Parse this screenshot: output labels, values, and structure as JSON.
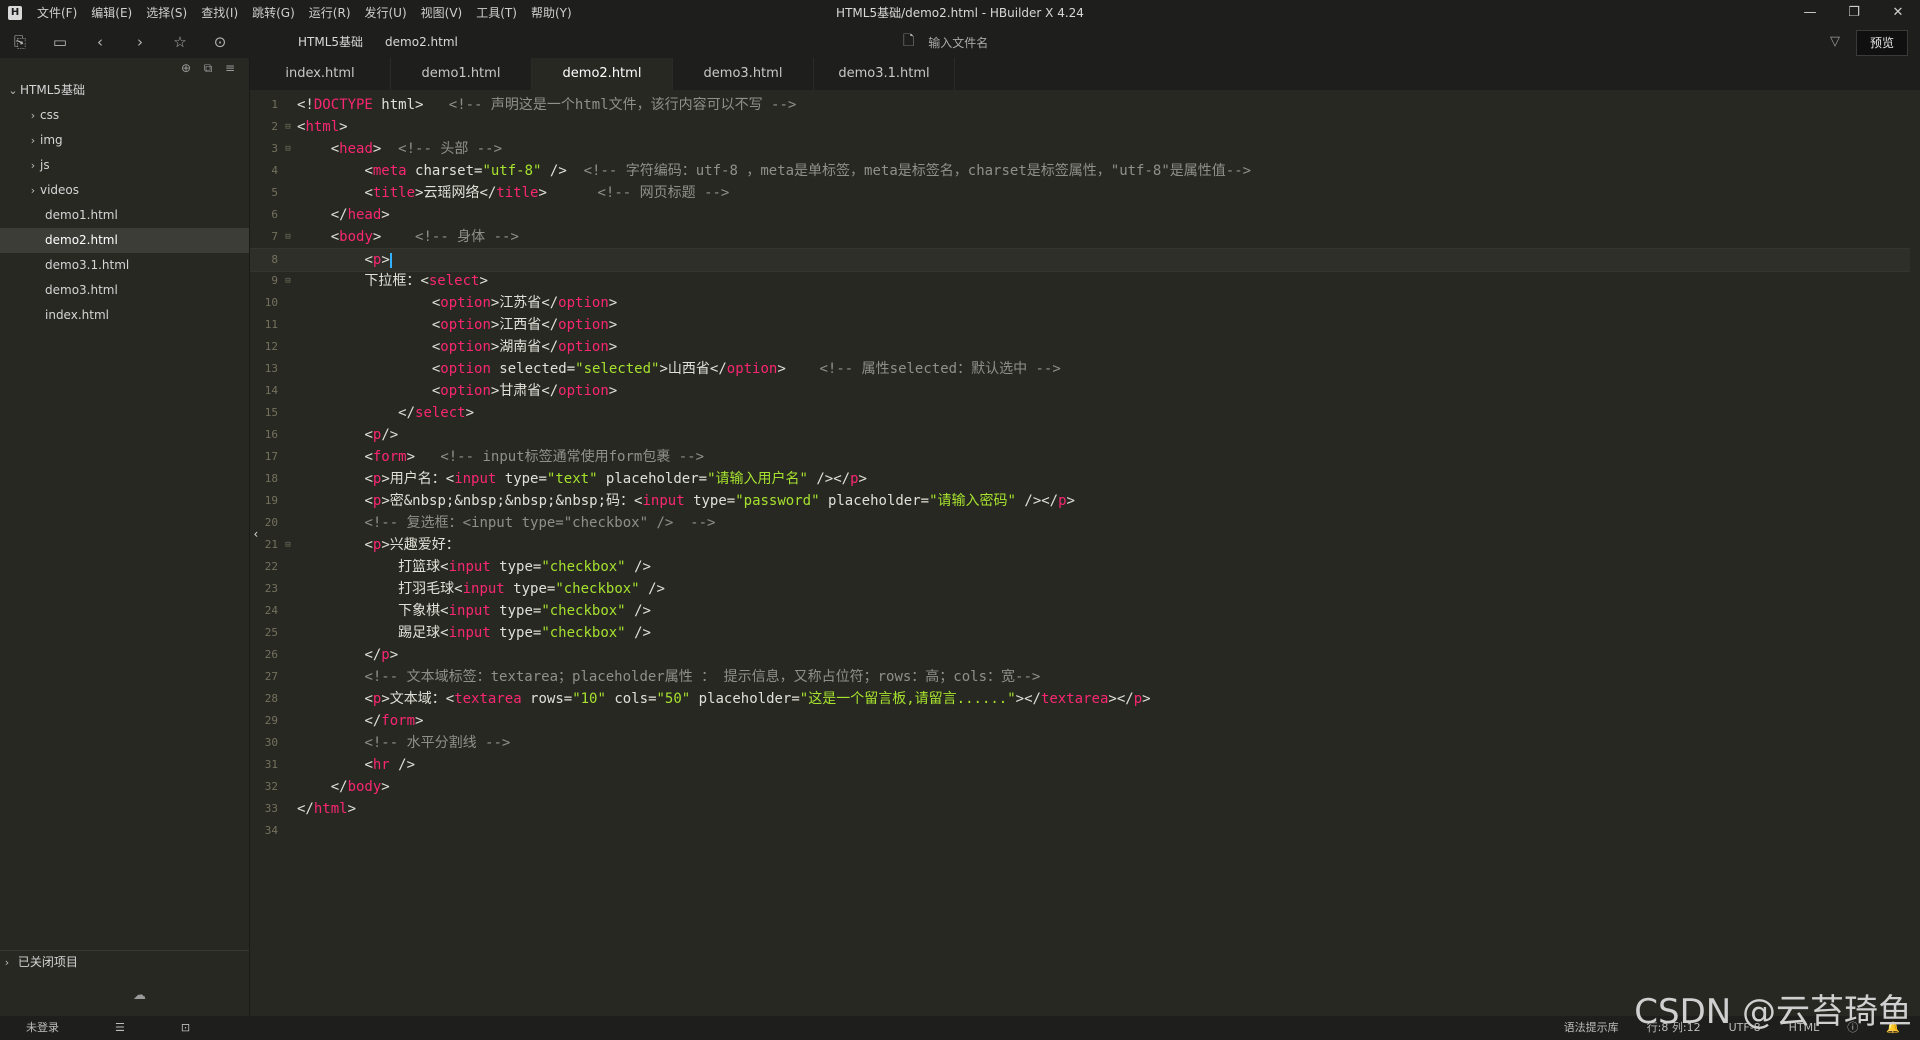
{
  "titlebar": {
    "menus": [
      "文件(F)",
      "编辑(E)",
      "选择(S)",
      "查找(I)",
      "跳转(G)",
      "运行(R)",
      "发行(U)",
      "视图(V)",
      "工具(T)",
      "帮助(Y)"
    ],
    "window_title": "HTML5基础/demo2.html - HBuilder X 4.24"
  },
  "toolbar": {
    "breadcrumb_project": "HTML5基础",
    "breadcrumb_file": "demo2.html",
    "file_search_placeholder": "输入文件名",
    "preview_label": "预览"
  },
  "sidebar": {
    "project_name": "HTML5基础",
    "folders": [
      "css",
      "img",
      "js",
      "videos"
    ],
    "files": [
      "demo1.html",
      "demo2.html",
      "demo3.1.html",
      "demo3.html",
      "index.html"
    ],
    "selected_file": "demo2.html",
    "closed_projects_label": "已关闭项目"
  },
  "tabs": [
    "index.html",
    "demo1.html",
    "demo2.html",
    "demo3.html",
    "demo3.1.html"
  ],
  "active_tab": "demo2.html",
  "editor": {
    "current_line": 8,
    "code_lines": [
      "<!DOCTYPE html>   <!-- 声明这是一个html文件，该行内容可以不写 -->",
      "<html>",
      "    <head>  <!-- 头部 -->",
      "        <meta charset=\"utf-8\" />  <!-- 字符编码：utf-8 ，meta是单标签，meta是标签名，charset是标签属性，\"utf-8\"是属性值-->",
      "        <title>云瑶网络</title>      <!-- 网页标题 -->",
      "    </head>",
      "    <body>    <!-- 身体 -->",
      "        <p>",
      "        下拉框：<select>",
      "                <option>江苏省</option>",
      "                <option>江西省</option>",
      "                <option>湖南省</option>",
      "                <option selected=\"selected\">山西省</option>    <!-- 属性selected：默认选中 -->",
      "                <option>甘肃省</option>",
      "            </select>",
      "        <p/>",
      "        <form>   <!-- input标签通常使用form包裹 -->",
      "        <p>用户名：<input type=\"text\" placeholder=\"请输入用户名\" /></p>",
      "        <p>密&nbsp;&nbsp;&nbsp;&nbsp;码：<input type=\"password\" placeholder=\"请输入密码\" /></p>",
      "        <!-- 复选框：<input type=\"checkbox\" />  -->",
      "        <p>兴趣爱好：",
      "            打篮球<input type=\"checkbox\" />",
      "            打羽毛球<input type=\"checkbox\" />",
      "            下象棋<input type=\"checkbox\" />",
      "            踢足球<input type=\"checkbox\" />",
      "        </p>",
      "        <!-- 文本域标签：textarea；placeholder属性 ： 提示信息，又称占位符；rows：高；cols：宽-->",
      "        <p>文本域：<textarea rows=\"10\" cols=\"50\" placeholder=\"这是一个留言板,请留言......\"></textarea></p>",
      "        </form>",
      "        <!-- 水平分割线 -->",
      "        <hr />",
      "    </body>",
      "</html>",
      ""
    ],
    "foldable_lines": [
      2,
      3,
      7,
      9,
      21
    ]
  },
  "statusbar": {
    "login": "未登录",
    "syntax_hint": "语法提示库",
    "position": "行:8  列:12",
    "encoding": "UTF-8",
    "language": "HTML"
  },
  "watermark": "CSDN @云苔琦鱼"
}
